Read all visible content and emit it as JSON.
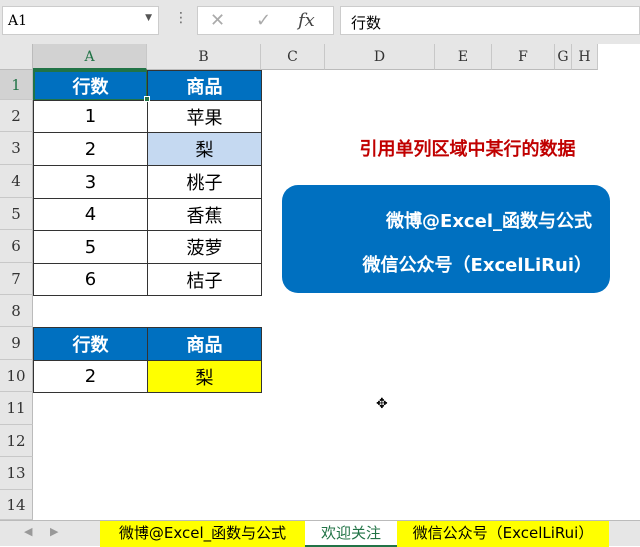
{
  "formula_bar": {
    "name_box": "A1",
    "formula": "行数",
    "cancel_icon": "✕",
    "enter_icon": "✓",
    "fx_label": "fx"
  },
  "columns": [
    "A",
    "B",
    "C",
    "D",
    "E",
    "F",
    "G",
    "H"
  ],
  "rows": [
    "1",
    "2",
    "3",
    "4",
    "5",
    "6",
    "7",
    "8",
    "9",
    "10",
    "11",
    "12",
    "13",
    "14"
  ],
  "table1": {
    "headers": [
      "行数",
      "商品"
    ],
    "rows": [
      [
        "1",
        "苹果"
      ],
      [
        "2",
        "梨"
      ],
      [
        "3",
        "桃子"
      ],
      [
        "4",
        "香蕉"
      ],
      [
        "5",
        "菠萝"
      ],
      [
        "6",
        "桔子"
      ]
    ]
  },
  "table2": {
    "headers": [
      "行数",
      "商品"
    ],
    "row": [
      "2",
      "梨"
    ]
  },
  "title": "引用单列区域中某行的数据",
  "banner": {
    "line1": "微博@Excel_函数与公式",
    "line2": "微信公众号（ExcelLiRui）"
  },
  "tabs": [
    "微博@Excel_函数与公式",
    "欢迎关注",
    "微信公众号（ExcelLiRui）"
  ],
  "colors": {
    "header_blue": "#0070c0",
    "highlight": "#c5d9f1",
    "yellow": "#ffff00",
    "title_red": "#c00000"
  }
}
